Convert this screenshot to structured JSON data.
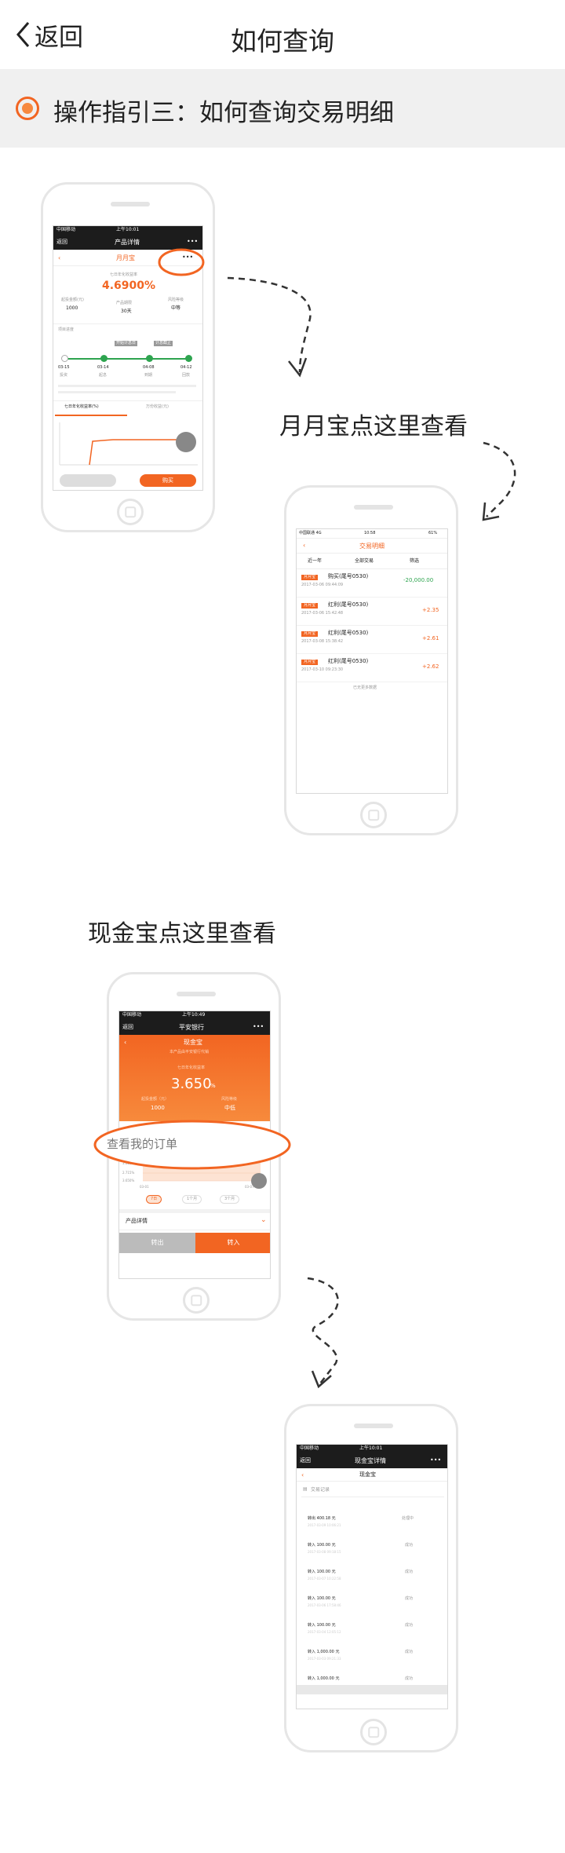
{
  "nav": {
    "back_label": "返回",
    "title": "如何查询"
  },
  "section": {
    "title": "操作指引三：如何查询交易明细"
  },
  "labels": {
    "yueyuebao": "月月宝点这里查看",
    "xianjinbao": "现金宝点这里查看"
  },
  "phone1": {
    "carrier": "中国移动",
    "time": "上午10:01",
    "back": "返回",
    "app_title": "产品详情",
    "product": "月月宝",
    "rate_label": "七日年化收益率",
    "rate": "4.6900%",
    "stats": [
      {
        "label": "起投金额(元)",
        "value": "1000"
      },
      {
        "label": "产品期限",
        "value": "30天"
      },
      {
        "label": "风险等级",
        "value": "中等"
      }
    ],
    "timeline_title": "项目进度",
    "timeline_tags": [
      "开始计息日",
      "计息截止"
    ],
    "timeline": [
      {
        "date": "03-15",
        "label": "投资"
      },
      {
        "date": "03-14",
        "label": "起息"
      },
      {
        "date": "04-08",
        "label": "到期"
      },
      {
        "date": "04-12",
        "label": "回款"
      }
    ],
    "tabs": [
      "七日年化收益率(%)",
      "万份收益(元)"
    ],
    "buy": "购买"
  },
  "phone2": {
    "carrier": "中国联通 4G",
    "time": "10:58",
    "battery": "61%",
    "title": "交易明细",
    "filters": [
      "近一年",
      "全部交易",
      "筛选"
    ],
    "rows": [
      {
        "tag": "月月宝",
        "name": "购买(尾号0530)",
        "date": "2017-03-06 09:44:09",
        "amount": "-20,000.00",
        "positive": false
      },
      {
        "tag": "月月宝",
        "name": "红利(尾号0530)",
        "date": "2017-03-06 15:42:48",
        "amount": "+2.35",
        "positive": true
      },
      {
        "tag": "月月宝",
        "name": "红利(尾号0530)",
        "date": "2017-03-08 15:38:42",
        "amount": "+2.61",
        "positive": true
      },
      {
        "tag": "月月宝",
        "name": "红利(尾号0530)",
        "date": "2017-03-10 09:23:30",
        "amount": "+2.62",
        "positive": true
      }
    ],
    "footer": "已无更多数据"
  },
  "phone3": {
    "carrier": "中国移动",
    "time": "上午10:49",
    "back": "返回",
    "app_title": "平安银行",
    "product": "现金宝",
    "subtitle": "本产品由平安银行代销",
    "rate_label": "七日年化收益率",
    "rate": "3.650",
    "rate_unit": "%",
    "left_label": "起投金额（元）",
    "left_value": "1000",
    "right_label": "风险等级",
    "right_value": "中低",
    "highlight": "查看我的订单",
    "y_ticks": [
      "3.650%",
      "3.338%",
      "3.026%",
      "2.715%",
      "3.650%"
    ],
    "x_ticks": [
      "03-01",
      "03-07"
    ],
    "ranges": [
      "7日",
      "1个月",
      "3个月"
    ],
    "detail": "产品详情",
    "sell": "转出",
    "buy": "转入"
  },
  "phone4": {
    "carrier": "中国移动",
    "time": "上午10:01",
    "back": "返回",
    "app_title": "现金宝详情",
    "product": "现金宝",
    "section": "交易记录",
    "rows": [
      {
        "name": "转出 400.18 元",
        "date": "2017-03-09 10:06:21",
        "status": "处理中"
      },
      {
        "name": "转入 100.00 元",
        "date": "2017-03-08 09:18:15",
        "status": "成功"
      },
      {
        "name": "转入 100.00 元",
        "date": "2017-03-07 10:22:58",
        "status": "成功"
      },
      {
        "name": "转入 100.00 元",
        "date": "2017-03-06 17:58:46",
        "status": "成功"
      },
      {
        "name": "转入 100.00 元",
        "date": "2017-03-04 12:05:12",
        "status": "成功"
      },
      {
        "name": "转入 1,000.00 元",
        "date": "2017-03-03 09:21:33",
        "status": "成功"
      },
      {
        "name": "转入 1,000.00 元",
        "date": "",
        "status": "成功"
      }
    ]
  },
  "colors": {
    "accent": "#f26522",
    "positive": "#f26522",
    "negative": "#2ea44f"
  }
}
